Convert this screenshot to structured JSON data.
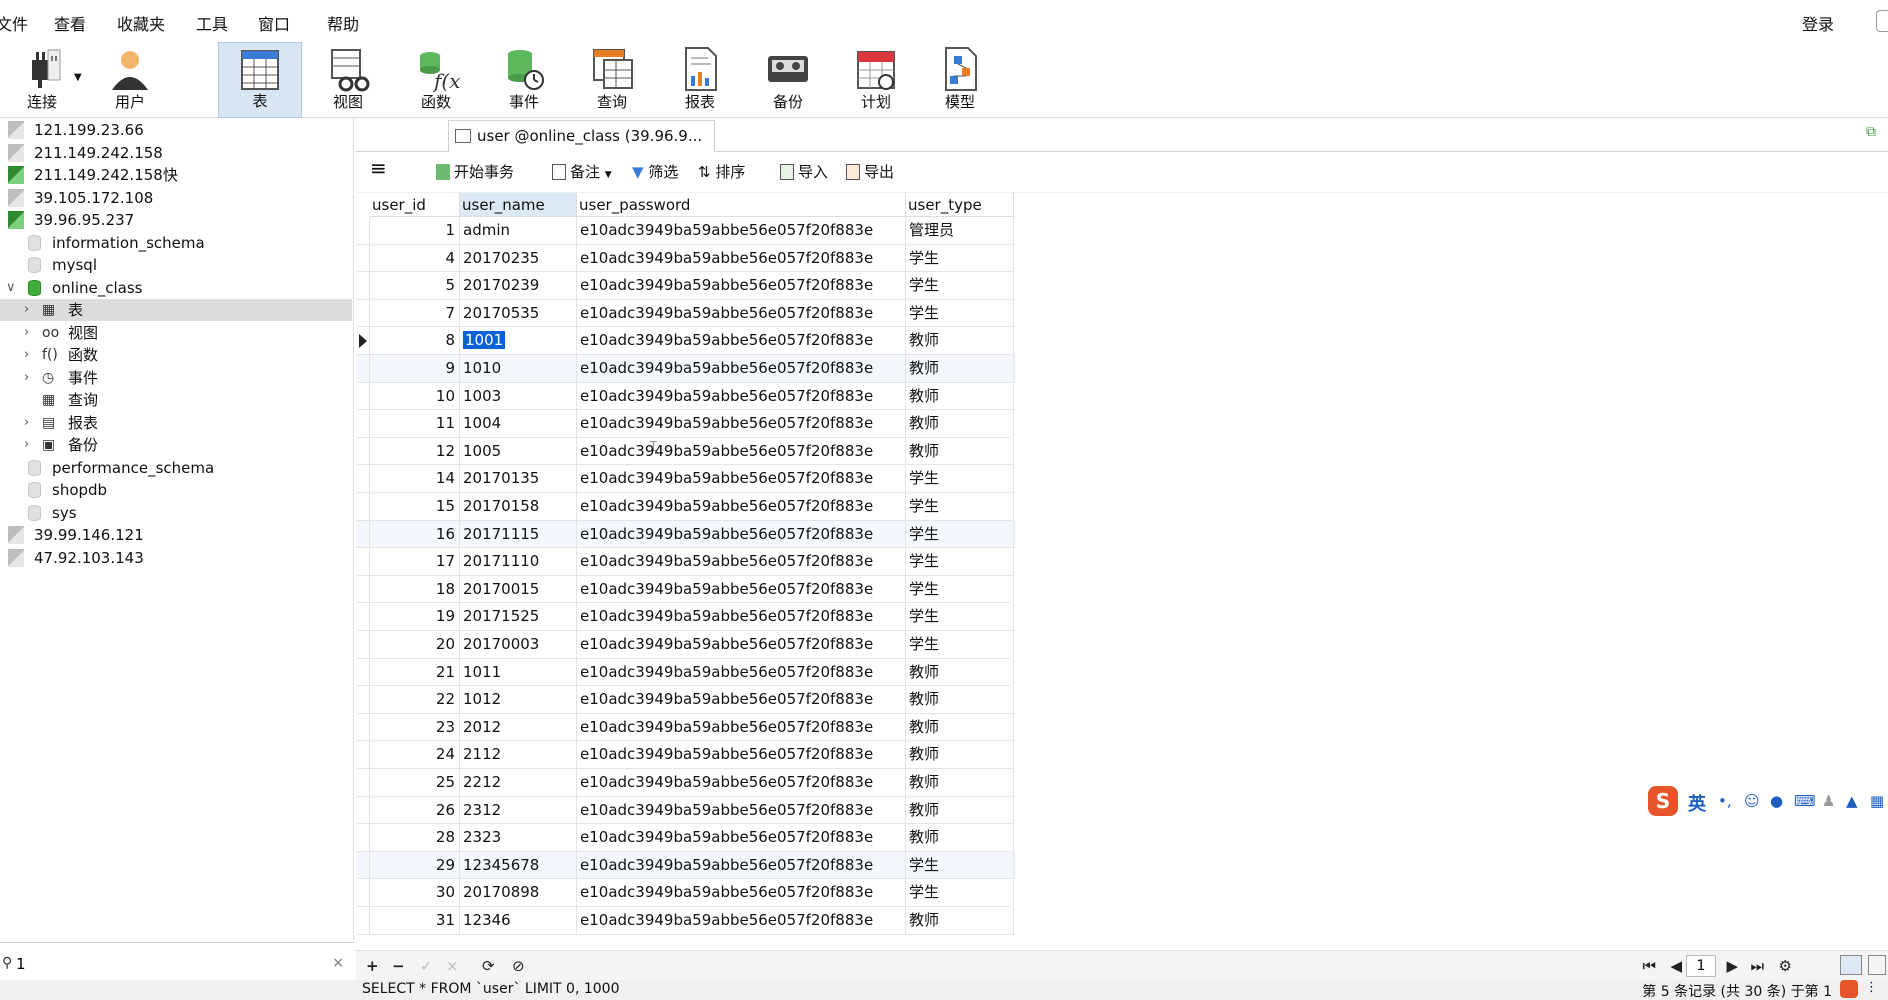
{
  "menu": [
    "文件",
    "查看",
    "收藏夹",
    "工具",
    "窗口",
    "帮助"
  ],
  "login": "登录",
  "toolbar": [
    {
      "label": "连接",
      "icon": "plug-icon"
    },
    {
      "label": "用户",
      "icon": "user-icon"
    },
    {
      "label": "表",
      "icon": "table-icon",
      "active": true
    },
    {
      "label": "视图",
      "icon": "view-icon"
    },
    {
      "label": "函数",
      "icon": "function-icon"
    },
    {
      "label": "事件",
      "icon": "event-icon"
    },
    {
      "label": "查询",
      "icon": "query-icon"
    },
    {
      "label": "报表",
      "icon": "report-icon"
    },
    {
      "label": "备份",
      "icon": "backup-icon"
    },
    {
      "label": "计划",
      "icon": "calendar-icon"
    },
    {
      "label": "模型",
      "icon": "model-icon"
    }
  ],
  "tree": [
    {
      "label": "121.199.23.66",
      "kind": "server",
      "depth": 0
    },
    {
      "label": "211.149.242.158",
      "kind": "server",
      "depth": 0
    },
    {
      "label": "211.149.242.158快",
      "kind": "server-green",
      "depth": 0
    },
    {
      "label": "39.105.172.108",
      "kind": "server",
      "depth": 0
    },
    {
      "label": "39.96.95.237",
      "kind": "server-green",
      "depth": 0
    },
    {
      "label": "information_schema",
      "kind": "db",
      "depth": 1
    },
    {
      "label": "mysql",
      "kind": "db",
      "depth": 1
    },
    {
      "label": "online_class",
      "kind": "db-green",
      "depth": 1,
      "expanded": true
    },
    {
      "label": "表",
      "kind": "obj",
      "icon": "▦",
      "depth": 2,
      "chev": true,
      "selected": true
    },
    {
      "label": "视图",
      "kind": "obj",
      "icon": "oo",
      "depth": 2,
      "chev": true
    },
    {
      "label": "函数",
      "kind": "obj",
      "icon": "f()",
      "depth": 2,
      "chev": true
    },
    {
      "label": "事件",
      "kind": "obj",
      "icon": "◷",
      "depth": 2,
      "chev": true
    },
    {
      "label": "查询",
      "kind": "obj",
      "icon": "▦",
      "depth": 2,
      "chev": false
    },
    {
      "label": "报表",
      "kind": "obj",
      "icon": "▤",
      "depth": 2,
      "chev": true
    },
    {
      "label": "备份",
      "kind": "obj",
      "icon": "▣",
      "depth": 2,
      "chev": true
    },
    {
      "label": "performance_schema",
      "kind": "db",
      "depth": 1
    },
    {
      "label": "shopdb",
      "kind": "db",
      "depth": 1
    },
    {
      "label": "sys",
      "kind": "db",
      "depth": 1
    },
    {
      "label": "39.99.146.121",
      "kind": "server",
      "depth": 0
    },
    {
      "label": "47.92.103.143",
      "kind": "server",
      "depth": 0
    }
  ],
  "search": {
    "value": "1",
    "clear": "×"
  },
  "tab": {
    "title": "user @online_class (39.96.9..."
  },
  "gridtools": {
    "menu_icon": "≡",
    "begin_txn": "开始事务",
    "note": "备注",
    "filter": "筛选",
    "sort": "排序",
    "import": "导入",
    "export": "导出"
  },
  "columns": [
    "user_id",
    "user_name",
    "user_password",
    "user_type"
  ],
  "rows": [
    [
      "1",
      "admin",
      "e10adc3949ba59abbe56e057f20f883e",
      "管理员"
    ],
    [
      "4",
      "20170235",
      "e10adc3949ba59abbe56e057f20f883e",
      "学生"
    ],
    [
      "5",
      "20170239",
      "e10adc3949ba59abbe56e057f20f883e",
      "学生"
    ],
    [
      "7",
      "20170535",
      "e10adc3949ba59abbe56e057f20f883e",
      "学生"
    ],
    [
      "8",
      "1001",
      "e10adc3949ba59abbe56e057f20f883e",
      "教师"
    ],
    [
      "9",
      "1010",
      "e10adc3949ba59abbe56e057f20f883e",
      "教师"
    ],
    [
      "10",
      "1003",
      "e10adc3949ba59abbe56e057f20f883e",
      "教师"
    ],
    [
      "11",
      "1004",
      "e10adc3949ba59abbe56e057f20f883e",
      "教师"
    ],
    [
      "12",
      "1005",
      "e10adc3949ba59abbe56e057f20f883e",
      "教师"
    ],
    [
      "14",
      "20170135",
      "e10adc3949ba59abbe56e057f20f883e",
      "学生"
    ],
    [
      "15",
      "20170158",
      "e10adc3949ba59abbe56e057f20f883e",
      "学生"
    ],
    [
      "16",
      "20171115",
      "e10adc3949ba59abbe56e057f20f883e",
      "学生"
    ],
    [
      "17",
      "20171110",
      "e10adc3949ba59abbe56e057f20f883e",
      "学生"
    ],
    [
      "18",
      "20170015",
      "e10adc3949ba59abbe56e057f20f883e",
      "学生"
    ],
    [
      "19",
      "20171525",
      "e10adc3949ba59abbe56e057f20f883e",
      "学生"
    ],
    [
      "20",
      "20170003",
      "e10adc3949ba59abbe56e057f20f883e",
      "学生"
    ],
    [
      "21",
      "1011",
      "e10adc3949ba59abbe56e057f20f883e",
      "教师"
    ],
    [
      "22",
      "1012",
      "e10adc3949ba59abbe56e057f20f883e",
      "教师"
    ],
    [
      "23",
      "2012",
      "e10adc3949ba59abbe56e057f20f883e",
      "教师"
    ],
    [
      "24",
      "2112",
      "e10adc3949ba59abbe56e057f20f883e",
      "教师"
    ],
    [
      "25",
      "2212",
      "e10adc3949ba59abbe56e057f20f883e",
      "教师"
    ],
    [
      "26",
      "2312",
      "e10adc3949ba59abbe56e057f20f883e",
      "教师"
    ],
    [
      "28",
      "2323",
      "e10adc3949ba59abbe56e057f20f883e",
      "教师"
    ],
    [
      "29",
      "12345678",
      "e10adc3949ba59abbe56e057f20f883e",
      "学生"
    ],
    [
      "30",
      "20170898",
      "e10adc3949ba59abbe56e057f20f883e",
      "学生"
    ],
    [
      "31",
      "12346",
      "e10adc3949ba59abbe56e057f20f883e",
      "教师"
    ]
  ],
  "current_row": 4,
  "selected_cell": {
    "row": 4,
    "col": 1
  },
  "footer": {
    "add": "+",
    "remove": "−",
    "apply": "✓",
    "discard": "×",
    "refresh": "⟳",
    "stop": "⊘",
    "page": "1"
  },
  "status": {
    "sql": "SELECT * FROM `user` LIMIT 0, 1000",
    "records": "第 5 条记录 (共 30 条) 于第 1"
  },
  "ime": {
    "logo": "S",
    "lang": "英"
  },
  "colors": {
    "selection": "#0b62d6",
    "toolbar_active": "#d8e6f4",
    "db_green": "#3fae3f",
    "ime": "#e8542a"
  }
}
